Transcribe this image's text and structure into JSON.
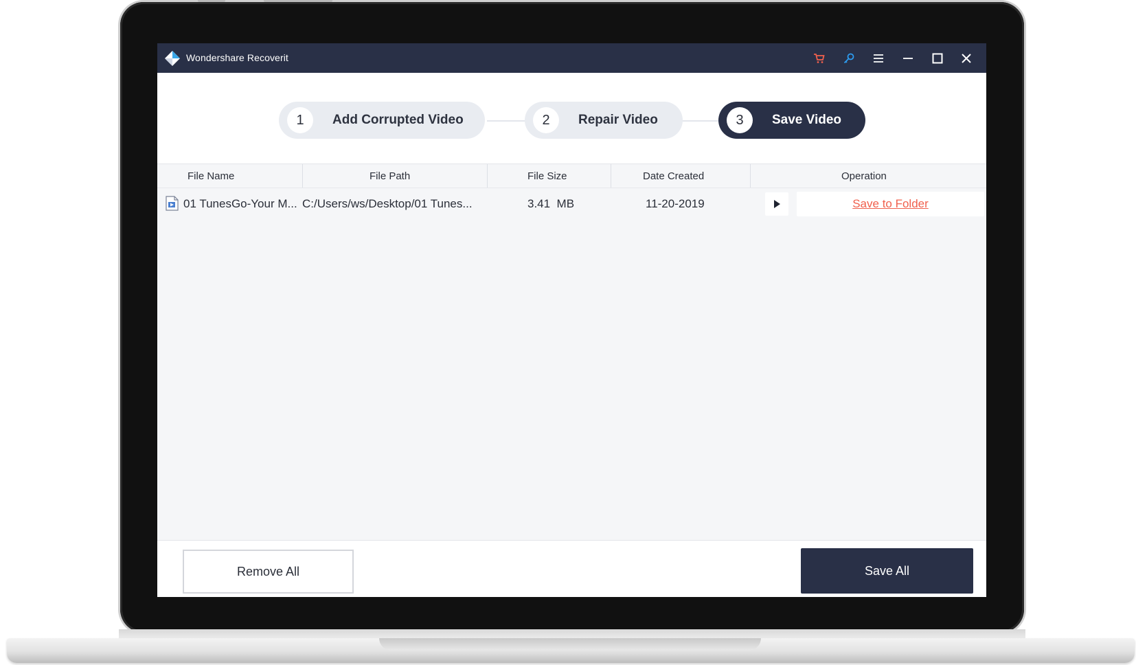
{
  "app": {
    "title": "Wondershare Recoverit",
    "titlebar_icons": [
      "cart-icon",
      "key-icon",
      "menu-icon",
      "minimize-icon",
      "maximize-icon",
      "close-icon"
    ]
  },
  "steps": [
    {
      "number": "1",
      "label": "Add Corrupted Video",
      "active": false
    },
    {
      "number": "2",
      "label": "Repair Video",
      "active": false
    },
    {
      "number": "3",
      "label": "Save Video",
      "active": true
    }
  ],
  "table": {
    "columns": [
      "File Name",
      "File Path",
      "File Size",
      "Date Created",
      "Operation"
    ],
    "rows": [
      {
        "file_name": "01 TunesGo-Your M...",
        "file_path": "C:/Users/ws/Desktop/01 Tunes...",
        "file_size": "3.41  MB",
        "date_created": "11-20-2019",
        "operation_link": "Save to Folder"
      }
    ]
  },
  "footer": {
    "remove_all": "Remove All",
    "save_all": "Save All"
  },
  "colors": {
    "titlebar": "#293047",
    "cart_icon": "#f0604d",
    "key_icon": "#2d9cf0",
    "link": "#f0604d",
    "primary_button": "#293047"
  }
}
